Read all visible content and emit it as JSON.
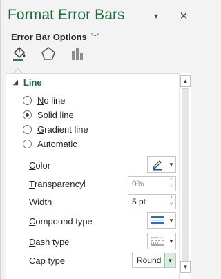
{
  "pane": {
    "title": "Format Error Bars",
    "dropdown_glyph": "▾",
    "close_glyph": "✕",
    "options_label": "Error Bar Options",
    "options_chevron": "﹀",
    "tabs": [
      {
        "name": "fill-line",
        "icon": "paint-bucket-icon"
      },
      {
        "name": "effects",
        "icon": "pentagon-icon"
      },
      {
        "name": "error-bar-options",
        "icon": "bar-chart-icon"
      }
    ]
  },
  "section": {
    "caret": "◢",
    "title": "Line"
  },
  "radios": [
    {
      "label_first": "N",
      "label_rest": "o line",
      "checked": false
    },
    {
      "label_first": "S",
      "label_rest": "olid line",
      "checked": true
    },
    {
      "label_first": "G",
      "label_rest": "radient line",
      "checked": false
    },
    {
      "label_first": "A",
      "label_rest": "utomatic",
      "checked": false
    }
  ],
  "props": {
    "color": {
      "label_first": "C",
      "label_rest": "olor",
      "icon": "pen-icon",
      "accent": "#1f4fb5"
    },
    "transparency": {
      "label_first": "T",
      "label_rest": "ransparency",
      "value": "0%",
      "level": 0
    },
    "width": {
      "label_first": "W",
      "label_rest": "idth",
      "value": "5 pt"
    },
    "compound": {
      "label_first": "C",
      "label_rest": "ompound type",
      "icon": "compound-lines-icon"
    },
    "dash": {
      "label_first": "D",
      "label_rest": "ash type",
      "icon": "dash-lines-icon"
    },
    "cap": {
      "label_first": "",
      "label_rest": "Cap type",
      "value": "Round"
    }
  },
  "scroll": {
    "up": "▲",
    "down": "▼"
  },
  "colors": {
    "title_green": "#1e6b3c",
    "accent_blue": "#2b6cc4",
    "select_arrow_bg": "#d8eddc"
  }
}
